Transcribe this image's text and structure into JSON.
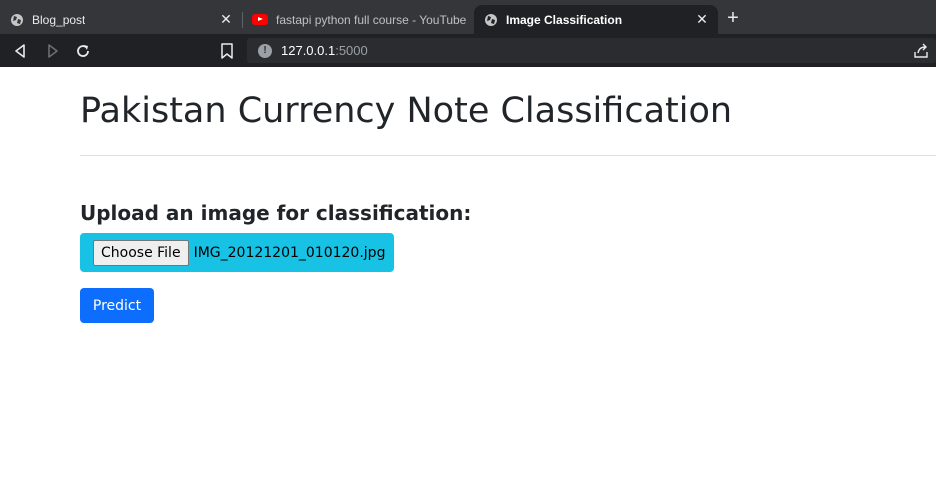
{
  "browser": {
    "tabs": [
      {
        "title": "Blog_post",
        "icon": "globe-icon",
        "close": "✕"
      },
      {
        "title": "fastapi python full course - YouTube",
        "icon": "youtube-icon"
      },
      {
        "title": "Image Classification",
        "icon": "globe-icon",
        "close": "✕",
        "active": true
      }
    ],
    "new_tab": "+",
    "url": {
      "host": "127.0.0.1",
      "port": ":5000"
    },
    "colors": {
      "tabstrip": "#35363a",
      "toolbar": "#202124",
      "omnibox": "#2b2c30"
    }
  },
  "page": {
    "title": "Pakistan Currency Note Classification",
    "upload_heading": "Upload an image for classification:",
    "file_input": {
      "button_label": "Choose File",
      "file_name": "IMG_20121201_010120.jpg"
    },
    "predict_label": "Predict",
    "colors": {
      "file_input_bg": "#17c2e4",
      "predict_bg": "#0d6efd",
      "text": "#212529"
    }
  }
}
